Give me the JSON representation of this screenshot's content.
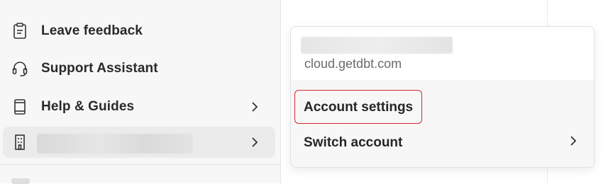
{
  "sidebar": {
    "items": [
      {
        "label": "Leave feedback",
        "icon": "clipboard-icon"
      },
      {
        "label": "Support Assistant",
        "icon": "headset-icon"
      },
      {
        "label": "Help & Guides",
        "icon": "book-icon"
      },
      {
        "label": "",
        "icon": "building-icon"
      }
    ]
  },
  "account_menu": {
    "domain": "cloud.getdbt.com",
    "items": [
      {
        "label": "Account settings",
        "highlighted": true
      },
      {
        "label": "Switch account"
      }
    ]
  },
  "colors": {
    "highlight_border": "#d8262d",
    "sidebar_bg": "#f7f7f7",
    "active_item_bg": "#ebebeb"
  }
}
